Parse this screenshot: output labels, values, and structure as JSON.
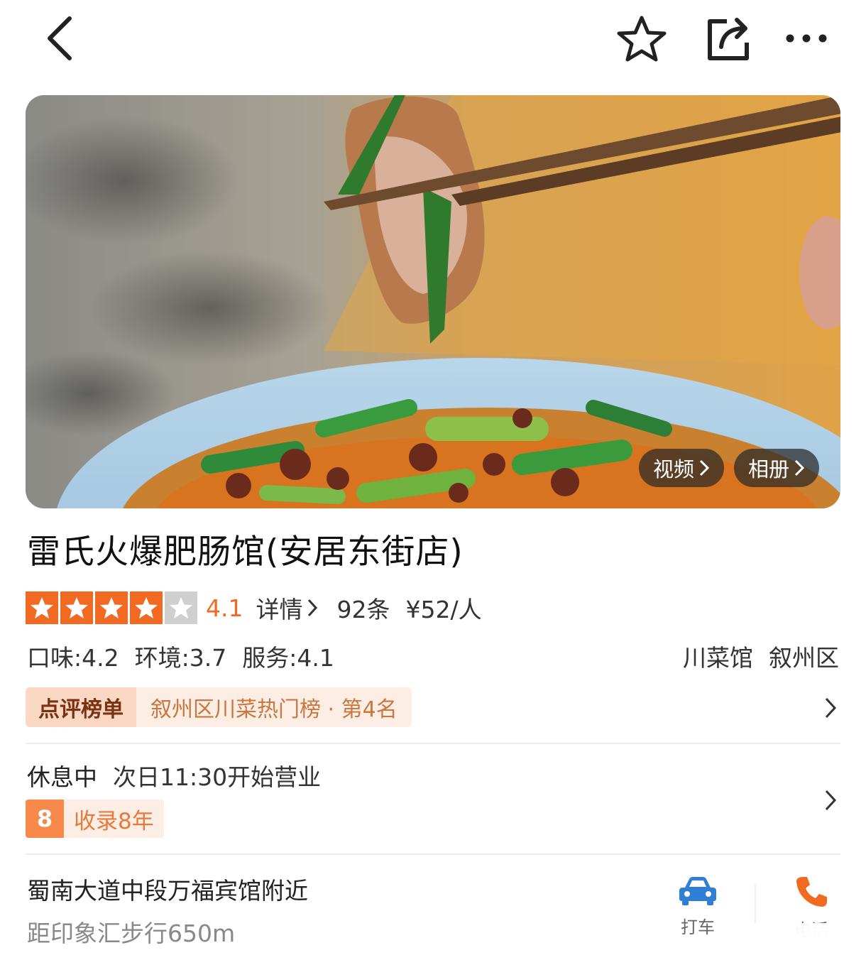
{
  "nav": {
    "icons": [
      "chevron-left-icon",
      "star-outline-icon",
      "share-icon",
      "more-dots-icon"
    ]
  },
  "hero": {
    "video_label": "视频",
    "album_label": "相册"
  },
  "shop": {
    "name": "雷氏火爆肥肠馆(安居东街店)",
    "rating_stars": 4,
    "rating_max": 5,
    "score": "4.1",
    "detail_label": "详情",
    "review_count": "92条",
    "price": "¥52/人",
    "sub_scores": [
      "口味:4.2",
      "环境:3.7",
      "服务:4.1"
    ],
    "tags": [
      "川菜馆",
      "叙州区"
    ]
  },
  "ranking": {
    "badge": "点评榜单",
    "text": "叙州区川菜热门榜 · 第4名"
  },
  "hours": {
    "status": "休息中",
    "next_open": "次日11:30开始营业",
    "since_num": "8",
    "since_text": "收录8年"
  },
  "address": {
    "line": "蜀南大道中段万福宾馆附近",
    "distance": "距印象汇步行650m",
    "taxi_label": "打车",
    "call_label": "电话"
  },
  "colors": {
    "accent": "#f26a22",
    "rank_badge_bg": "#fbd8c4",
    "rank_bg": "#fdeee5",
    "call_icon": "#f26a22",
    "taxi_icon": "#2f7fd6"
  }
}
